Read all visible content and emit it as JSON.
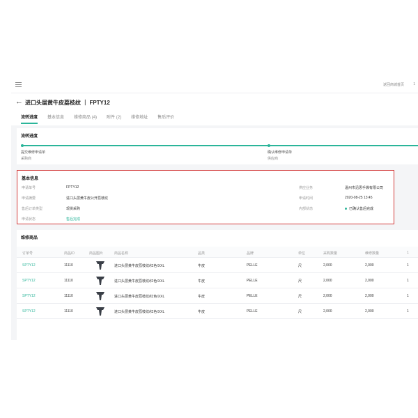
{
  "topbar": {
    "link": "返回商城首页",
    "number": "1"
  },
  "header": {
    "title": "进口头层黄牛皮荔枝纹 ｜ FPTY12"
  },
  "tabs": [
    "流转进度",
    "基本信息",
    "维修商品 (4)",
    "附件 (2)",
    "维修地址",
    "售后评价"
  ],
  "progress": {
    "title": "流转进度",
    "steps": [
      {
        "label": "提交维修申请单",
        "sub": "采购商"
      },
      {
        "label": "确认维修申请单",
        "sub": "供应商"
      }
    ]
  },
  "info": {
    "title": "基本信息",
    "left": [
      {
        "label": "申请单号",
        "value": "FPTY12"
      },
      {
        "label": "申请摘要",
        "value": "进口头层黄牛皮公开荔枝纹"
      },
      {
        "label": "售后订单类型",
        "value": "现货采购"
      },
      {
        "label": "申请状态",
        "value": "售后完成"
      }
    ],
    "right": [
      {
        "label": "供应业务",
        "value": "温州市迅思手袋有限公司"
      },
      {
        "label": "申请时间",
        "value": "2020-08-25 13:45"
      },
      {
        "label": "内部状态",
        "value": "已确认售后完成"
      }
    ]
  },
  "goods": {
    "title": "维修商品",
    "columns": [
      "订单号",
      "商品ID",
      "商品图片",
      "商品名称",
      "品类",
      "品牌",
      "单位",
      "采购数量",
      "维修数量",
      "1"
    ],
    "rows": [
      {
        "order": "SPTY12",
        "id": "11110",
        "name": "进口头层黄牛皮荔枝纹/红色/XXL",
        "category": "牛皮",
        "brand": "PELLE",
        "unit": "尺",
        "qty": "2,000",
        "repair": "2,000",
        "extra": "1"
      },
      {
        "order": "SPTY12",
        "id": "11110",
        "name": "进口头层黄牛皮荔枝纹/红色/XXL",
        "category": "牛皮",
        "brand": "PELLE",
        "unit": "尺",
        "qty": "2,000",
        "repair": "2,000",
        "extra": "1"
      },
      {
        "order": "SPTY12",
        "id": "11110",
        "name": "进口头层黄牛皮荔枝纹/红色/XXL",
        "category": "牛皮",
        "brand": "PELLE",
        "unit": "尺",
        "qty": "2,000",
        "repair": "2,000",
        "extra": "1"
      },
      {
        "order": "SPTY12",
        "id": "11110",
        "name": "进口头层黄牛皮荔枝纹/红色/XXL",
        "category": "牛皮",
        "brand": "PELLE",
        "unit": "尺",
        "qty": "2,000",
        "repair": "2,000",
        "extra": "1"
      }
    ]
  },
  "colors": {
    "accent": "#2bb59a",
    "highlight_border": "#d33a3a"
  }
}
